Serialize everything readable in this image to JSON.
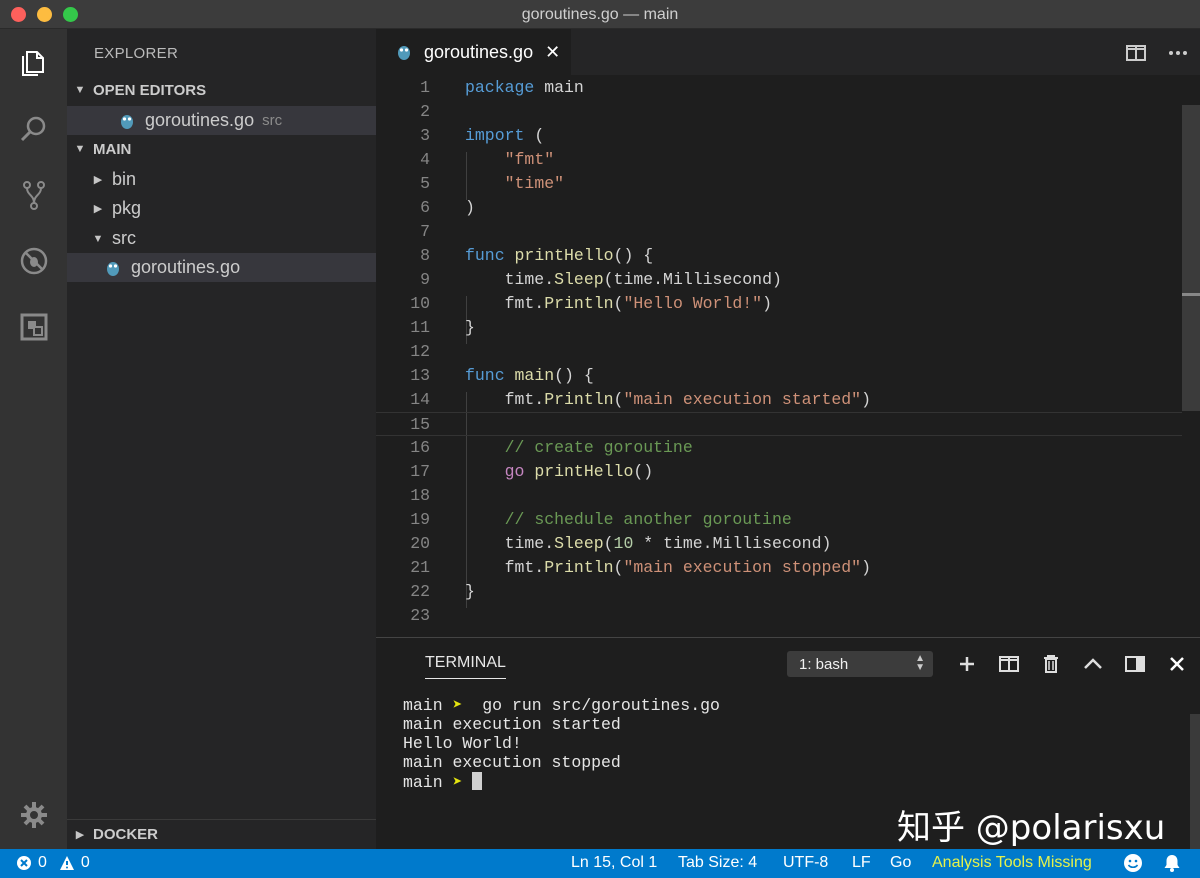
{
  "window": {
    "title": "goroutines.go — main"
  },
  "sidebar": {
    "title": "EXPLORER",
    "open_editors": {
      "label": "OPEN EDITORS",
      "items": [
        {
          "name": "goroutines.go",
          "hint": "src"
        }
      ]
    },
    "main": {
      "label": "MAIN",
      "items": [
        {
          "name": "bin"
        },
        {
          "name": "pkg"
        },
        {
          "name": "src"
        },
        {
          "name": "goroutines.go"
        }
      ]
    },
    "docker": {
      "label": "DOCKER"
    }
  },
  "editor": {
    "tab": {
      "label": "goroutines.go",
      "close": "✕"
    },
    "line_numbers": [
      "1",
      "2",
      "3",
      "4",
      "5",
      "6",
      "7",
      "8",
      "9",
      "10",
      "11",
      "12",
      "13",
      "14",
      "15",
      "16",
      "17",
      "18",
      "19",
      "20",
      "21",
      "22",
      "23"
    ],
    "code": [
      "package main",
      "",
      "import (",
      "    \"fmt\"",
      "    \"time\"",
      ")",
      "",
      "func printHello() {",
      "    time.Sleep(time.Millisecond)",
      "    fmt.Println(\"Hello World!\")",
      "}",
      "",
      "func main() {",
      "    fmt.Println(\"main execution started\")",
      "",
      "    // create goroutine",
      "    go printHello()",
      "",
      "    // schedule another goroutine",
      "    time.Sleep(10 * time.Millisecond)",
      "    fmt.Println(\"main execution stopped\")",
      "}",
      ""
    ],
    "current_line": 15
  },
  "terminal": {
    "title": "TERMINAL",
    "selected_shell": "1: bash",
    "prompt_dir": "main",
    "prompt_symbol": "➤",
    "command": "go run src/goroutines.go",
    "output": [
      "main execution started",
      "Hello World!",
      "main execution stopped"
    ]
  },
  "statusbar": {
    "errors": "0",
    "warnings": "0",
    "position": "Ln 15, Col 1",
    "tab_size": "Tab Size: 4",
    "encoding": "UTF-8",
    "eol": "LF",
    "language": "Go",
    "warning_text": "Analysis Tools Missing"
  },
  "watermark": "知乎 @polarisxu",
  "colors": {
    "accent": "#007acc",
    "keyword": "#569cd6",
    "string": "#ce9178",
    "function": "#dcdcaa",
    "comment": "#6a9955",
    "warning_text": "#e6f24b"
  }
}
